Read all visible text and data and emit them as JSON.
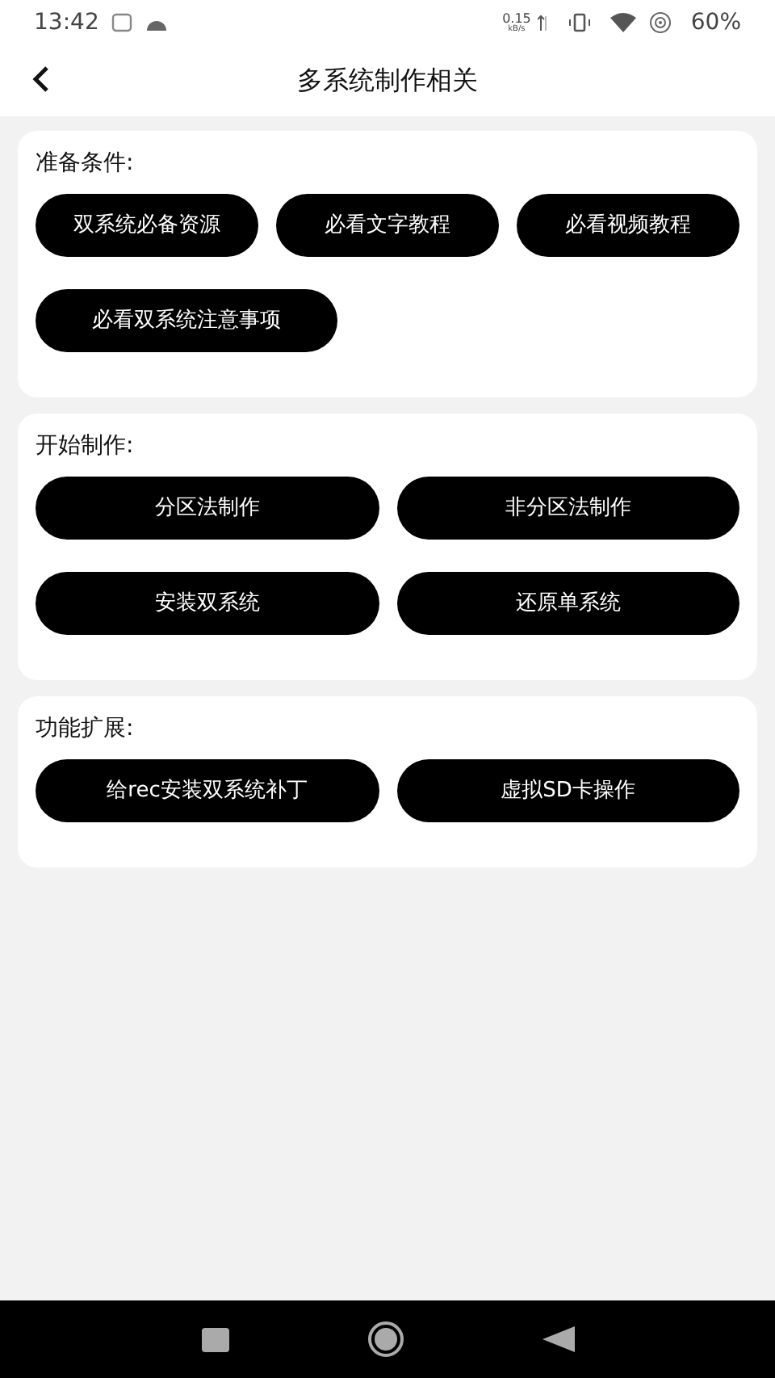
{
  "status_bar": {
    "time": "13:42",
    "speed": "0.15",
    "speed_unit": "kB/s",
    "battery": "60%"
  },
  "header": {
    "title": "多系统制作相关"
  },
  "sections": [
    {
      "title": "准备条件:",
      "kind": "wrap",
      "buttons": [
        "双系统必备资源",
        "必看文字教程",
        "必看视频教程",
        "必看双系统注意事项"
      ]
    },
    {
      "title": "开始制作:",
      "kind": "grid",
      "buttons": [
        "分区法制作",
        "非分区法制作",
        "安装双系统",
        "还原单系统"
      ]
    },
    {
      "title": "功能扩展:",
      "kind": "grid",
      "buttons": [
        "给rec安装双系统补丁",
        "虚拟SD卡操作"
      ]
    }
  ]
}
